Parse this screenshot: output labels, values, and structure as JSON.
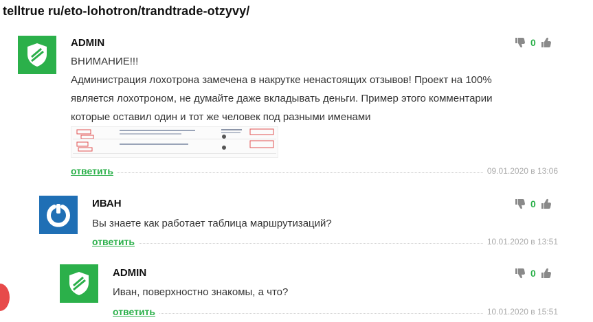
{
  "page": {
    "title": "telltrue ru/eto-lohotron/trandtrade-otzyvy/"
  },
  "comments": [
    {
      "author": "ADMIN",
      "avatar": "shield-logo",
      "avatar_color": "#2bb04a",
      "text_lines": [
        "ВНИМАНИЕ!!!",
        "Администрация лохотрона замечена в накрутке ненастоящих отзывов! Проект на 100%",
        "является лохотроном, не думайте даже вкладывать деньги. Пример этого комментарии",
        "которые оставил один и тот же человек под разными именами"
      ],
      "rating": "0",
      "reply_label": "ответить",
      "date": "09.01.2020 в 13:06"
    },
    {
      "author": "ИВАН",
      "avatar": "power-logo",
      "avatar_color": "#1f6fb5",
      "text_lines": [
        "Вы знаете как работает таблица маршрутизаций?"
      ],
      "rating": "0",
      "reply_label": "ответить",
      "date": "10.01.2020 в 13:51"
    },
    {
      "author": "ADMIN",
      "avatar": "shield-logo",
      "avatar_color": "#2bb04a",
      "text_lines": [
        "Иван, поверхностно знакомы, а что?"
      ],
      "rating": "0",
      "reply_label": "ответить",
      "date": "10.01.2020 в 15:51"
    }
  ],
  "icons": {
    "thumb_down": "thumb-down-icon",
    "thumb_up": "thumb-up-icon"
  },
  "colors": {
    "accent": "#2bb04a",
    "date": "#aaaaaa",
    "text": "#333333"
  }
}
